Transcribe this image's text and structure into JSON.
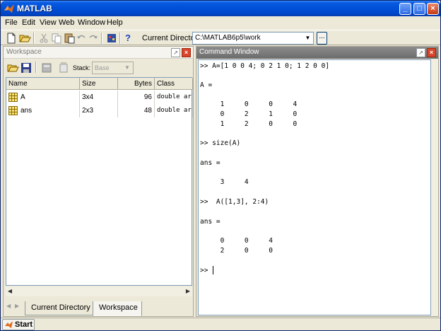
{
  "window": {
    "title": "MATLAB",
    "minimize": "_",
    "maximize": "□",
    "close": "×"
  },
  "menu": [
    {
      "label": "File",
      "key": "F"
    },
    {
      "label": "Edit",
      "key": "E"
    },
    {
      "label": "View",
      "key": "V"
    },
    {
      "label": "Web",
      "key": "W"
    },
    {
      "label": "Window",
      "key": "W"
    },
    {
      "label": "Help",
      "key": "H"
    }
  ],
  "toolbar": {
    "current_directory_label": "Current Directory:",
    "current_directory_value": "C:\\MATLAB6p5\\work",
    "browse_label": "...",
    "help_label": "?"
  },
  "workspace": {
    "title": "Workspace",
    "stack_label": "Stack:",
    "stack_value": "Base",
    "columns": [
      "Name",
      "Size",
      "Bytes",
      "Class"
    ],
    "rows": [
      {
        "name": "A",
        "size": "3x4",
        "bytes": "96",
        "class": "double arr"
      },
      {
        "name": "ans",
        "size": "2x3",
        "bytes": "48",
        "class": "double arr"
      }
    ],
    "tabs": [
      "Current Directory",
      "Workspace"
    ],
    "active_tab": "Workspace"
  },
  "command_window": {
    "title": "Command Window",
    "lines": [
      ">> A=[1 0 0 4; 0 2 1 0; 1 2 0 0]",
      "",
      "A =",
      "",
      "     1     0     0     4",
      "     0     2     1     0",
      "     1     2     0     0",
      "",
      ">> size(A)",
      "",
      "ans =",
      "",
      "     3     4",
      "",
      ">>  A([1,3], 2:4)",
      "",
      "ans =",
      "",
      "     0     0     4",
      "     2     0     0",
      "",
      ">> "
    ]
  },
  "taskbar": {
    "start_label": "Start"
  }
}
